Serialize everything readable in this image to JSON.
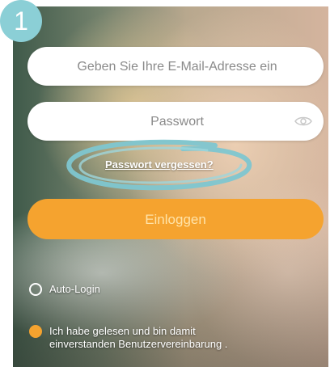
{
  "step": {
    "number": "1"
  },
  "login_form": {
    "email_placeholder": "Geben Sie Ihre E-Mail-Adresse ein",
    "password_placeholder": "Passwort",
    "password_icon": "eye-icon",
    "forgot_label": "Passwort vergessen?",
    "login_label": "Einloggen",
    "auto_login": {
      "label": "Auto-Login",
      "checked": false
    },
    "terms": {
      "line1": "Ich habe gelesen und bin damit",
      "line2": "einverstanden Benutzervereinbarung .",
      "checked": true
    }
  },
  "colors": {
    "accent": "#f5a32f",
    "badge": "#8bcfd6",
    "highlight": "#7ec6d0"
  }
}
